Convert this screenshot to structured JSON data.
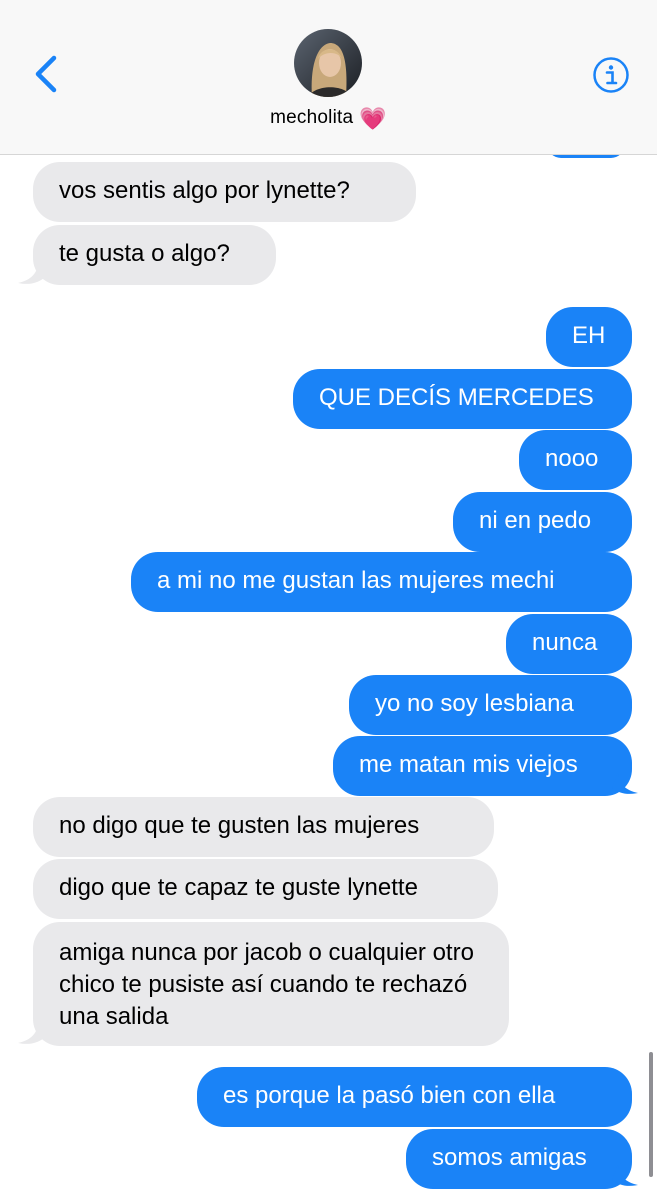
{
  "header": {
    "contact_name": "mecholita",
    "contact_emoji": "💗",
    "back_icon": "chevron-left-icon",
    "info_icon": "info-icon"
  },
  "messages": [
    {
      "side": "in",
      "text": "vos sentis algo por lynette?"
    },
    {
      "side": "in",
      "text": "te gusta o algo?"
    },
    {
      "side": "out",
      "text": "EH"
    },
    {
      "side": "out",
      "text": "QUE DECÍS MERCEDES"
    },
    {
      "side": "out",
      "text": "nooo"
    },
    {
      "side": "out",
      "text": "ni en pedo"
    },
    {
      "side": "out",
      "text": "a mi no me gustan las mujeres mechi"
    },
    {
      "side": "out",
      "text": "nunca"
    },
    {
      "side": "out",
      "text": "yo no soy lesbiana "
    },
    {
      "side": "out",
      "text": "me matan mis viejos"
    },
    {
      "side": "in",
      "text": "no digo que te gusten las mujeres"
    },
    {
      "side": "in",
      "text": "digo que te capaz te guste lynette"
    },
    {
      "side": "in",
      "text": "amiga nunca por jacob o cualquier otro chico te pusiste así cuando te rechazó una salida"
    },
    {
      "side": "out",
      "text": "es porque la pasó bien con ella"
    },
    {
      "side": "out",
      "text": "somos amigas"
    }
  ],
  "colors": {
    "outgoing": "#1a83f7",
    "incoming": "#e9e9eb",
    "accent": "#1a83f7"
  }
}
